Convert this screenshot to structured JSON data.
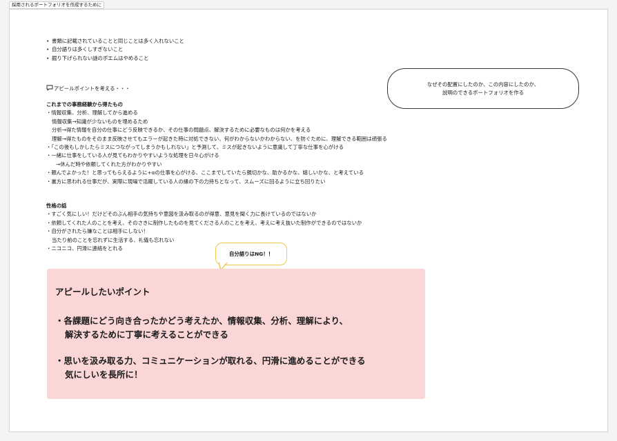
{
  "frame": {
    "label": "採用されるポートフォリオを作成するために"
  },
  "cautions": [
    "書類に記載されていることと同じことは多く入れないこと",
    "自分語りは多くしすぎないこと",
    "掘り下げられない謎のポエムはやめること"
  ],
  "bullet_char": "•",
  "appeal_heading": "アピールポイントを考える・・・",
  "experience": {
    "heading": "これまでの事務経験から得たもの",
    "lines": [
      "・情報収集、分析、理解してから進める",
      "情報収集→知識が少ないものを埋めるため",
      "分析→得た情報を自分の仕事にどう反映できるか、その仕事の問題点、解決するために必要なものは何かを考える",
      "理解→得たものをそのまま反映させてもエラーが起きた時に対処できない、何がわからないかわからない、を防ぐために、理解できる範囲は頑張る",
      "・「この後もしかしたらミスにつながってしまうかもしれない」と予測して、ミスが起きないように意識して丁寧な仕事を心がける",
      "・一緒に仕事をしている人が見てもわかりやすいような処理を日々心がける",
      "→休んだ時や依頼してくれた方がわかりやすい",
      "・頼んでよかった！と思ってもらえるように+αの仕事を心がける、ここまでしていたら親切かな、助かるかな、嬉しいかな、と考えている",
      "・裏方に思われる仕事だが、実際に現場で活躍している人の縁の下の力持ちとなって、スムーズに回るように立ち回りたい"
    ]
  },
  "personality": {
    "heading": "性格の話",
    "lines": [
      "・すごく気にしい！だけどそのぶん相手の気持ちや意図を汲み取るのが得意、意見を聞く力に長けているのではないか",
      "・依頼してくれた人のことを考え、そのさきに制作したものを見てくださる人のことを考え、考えに考え抜いた制作ができるのではないか",
      "・自分がされたら嫌なことは相手にしない！",
      "当たり前のことを忘れずに生活する、礼儀も忘れない",
      "・ニコニコ、円滑に連絡をとれる"
    ]
  },
  "note_bubble": {
    "line1": "なぜその配置にしたのか、この内容にしたのか、",
    "line2": "説明のできるポートフォリオを作る"
  },
  "callout": {
    "text": "自分語りはNG！！"
  },
  "appeal_box": {
    "title": "アピールしたいポイント",
    "point1_line1": "・各課題にどう向き合ったかどう考えたか、情報収集、分析、理解により、",
    "point1_line2": "解決するために丁寧に考えることができる",
    "point2_line1": "・思いを汲み取る力、コミュニケーションが取れる、円滑に進めることができる",
    "point2_line2": "気にしいを長所に！"
  },
  "colors": {
    "appeal_box_bg": "#fbd6d6",
    "callout_border": "#f0c64a",
    "bubble_border": "#333333"
  }
}
